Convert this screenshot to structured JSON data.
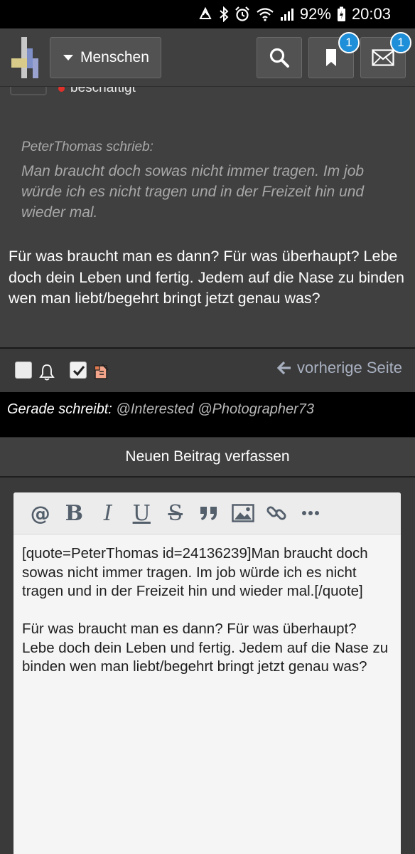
{
  "statusbar": {
    "battery": "92%",
    "time": "20:03"
  },
  "nav": {
    "menu_label": "Menschen",
    "bookmarks_badge": "1",
    "messages_badge": "1"
  },
  "post": {
    "status": "beschäftigt",
    "quote_author": "PeterThomas schrieb:",
    "quote_text": "Man braucht doch sowas nicht immer tragen. Im job würde ich es nicht tragen und in der Freizeit hin und wieder mal.",
    "reply_text": "Für was braucht man es dann? Für was überhaupt? Lebe doch dein Leben und fertig. Jedem auf die Nase zu binden wen man liebt/begehrt bringt jetzt genau was?"
  },
  "actions": {
    "prev_page_label": "vorherige Seite"
  },
  "typing": {
    "label": "Gerade schreibt:",
    "users": "@Interested @Photographer73"
  },
  "new_post": {
    "title": "Neuen Beitrag verfassen"
  },
  "editor": {
    "content": "[quote=PeterThomas id=24136239]Man braucht doch sowas nicht immer tragen. Im job würde ich es nicht tragen und in der Freizeit hin und wieder mal.[/quote]\n\nFür was braucht man es dann? Für was überhaupt? Lebe doch dein Leben und fertig. Jedem auf die Nase zu binden wen man liebt/begehrt bringt jetzt genau was?",
    "toolbar": [
      "mention-icon",
      "bold-icon",
      "italic-icon",
      "underline-icon",
      "strikethrough-icon",
      "quote-icon",
      "image-icon",
      "link-icon",
      "more-icon"
    ]
  },
  "colors": {
    "badge": "#1e8fd8",
    "status_dot": "#e0302a",
    "background": "#404040",
    "link": "#a8b0c0"
  }
}
